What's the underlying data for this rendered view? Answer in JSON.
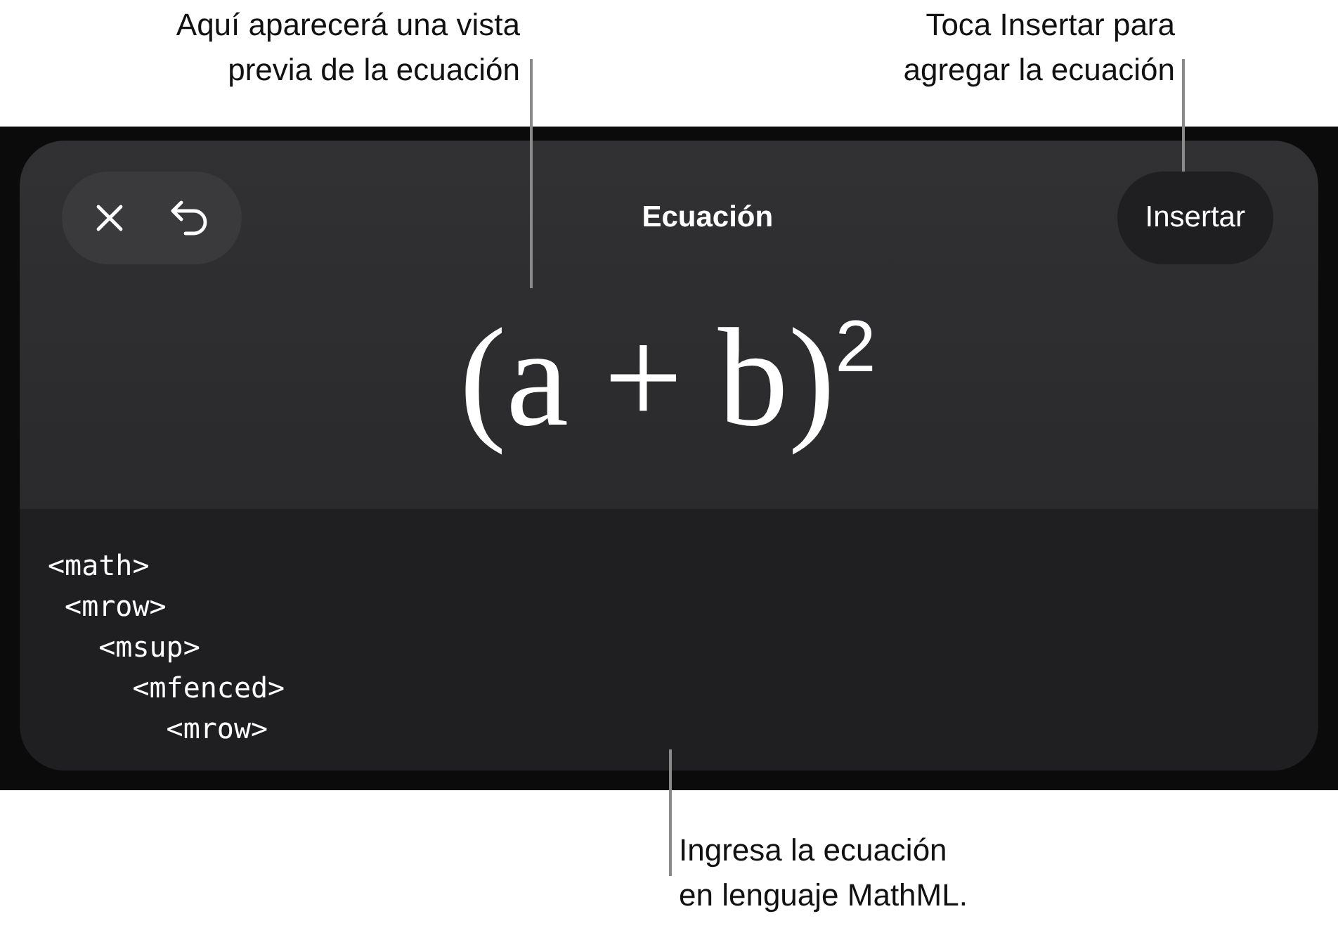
{
  "preview_callout": {
    "lines": [
      "Aquí aparecerá una vista",
      "previa de la ecuación"
    ]
  },
  "insert_callout": {
    "lines": [
      "Toca Insertar para",
      "agregar la ecuación"
    ]
  },
  "toolbar": {
    "title": "Ecuación",
    "insert_button": "Insertar"
  },
  "equation_preview": "(a + b)$^{2}$",
  "mathml_editor": {
    "lines": [
      "<math>",
      " <mrow>",
      "   <msup>",
      "     <mfenced>",
      "       <mrow>"
    ]
  },
  "editor_callout": {
    "lines": [
      "Ingresa la ecuación",
      "en lenguaje MathML."
    ]
  }
}
